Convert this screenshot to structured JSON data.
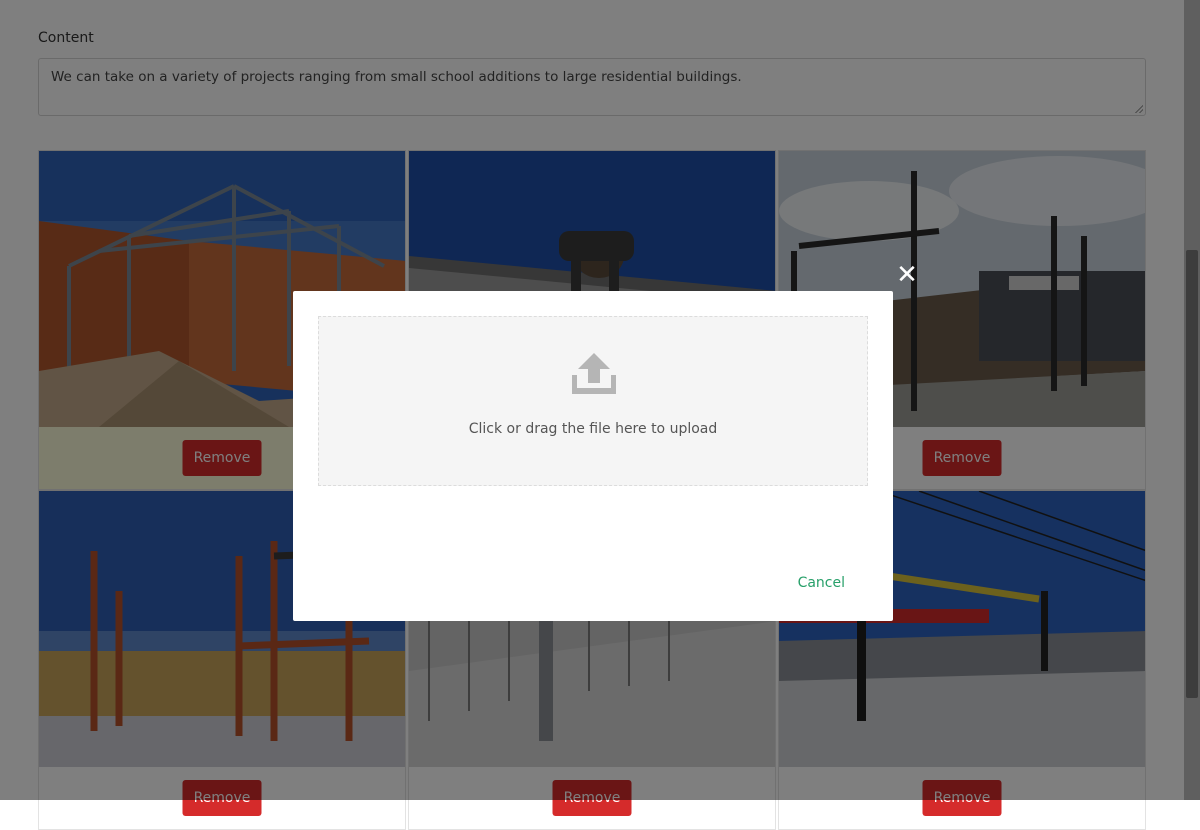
{
  "form": {
    "content_label": "Content",
    "content_value": "We can take on a variety of projects ranging from small school additions to large residential buildings."
  },
  "gallery": {
    "remove_label": "Remove"
  },
  "modal": {
    "close_symbol": "✕",
    "upload_icon": "upload-icon",
    "dropzone_text": "Click or drag the file here to upload",
    "cancel_label": "Cancel"
  },
  "colors": {
    "remove_button": "#d52b2b",
    "cancel_link": "#28a06a",
    "overlay": "rgba(0,0,0,0.5)",
    "highlight_tile": "#fbfbd8"
  }
}
